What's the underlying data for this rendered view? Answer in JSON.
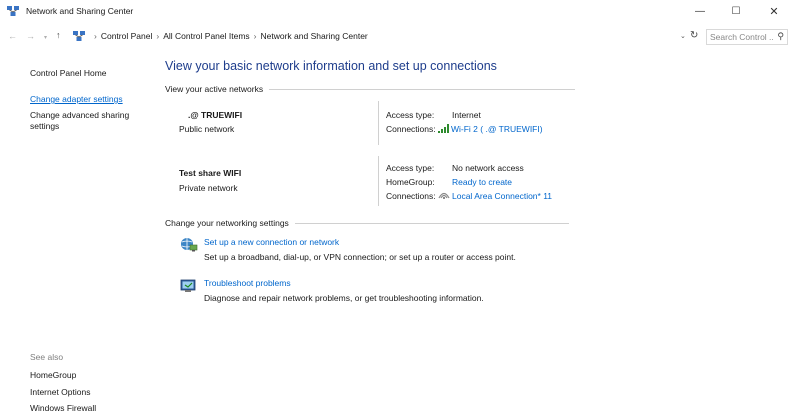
{
  "window": {
    "title": "Network and Sharing Center",
    "minimize_glyph": "—",
    "maximize_glyph": "☐",
    "close_glyph": "✕"
  },
  "address": {
    "back_glyph": "←",
    "forward_glyph": "→",
    "recent_glyph": "▾",
    "up_glyph": "↑",
    "breadcrumbs": [
      "Control Panel",
      "All Control Panel Items",
      "Network and Sharing Center"
    ],
    "breadcrumb_sep": "›",
    "dropdown_glyph": "⌄",
    "refresh_glyph": "↻",
    "search_placeholder": "Search Control ...",
    "search_glyph": "⚲"
  },
  "sidebar": {
    "home": "Control Panel Home",
    "adapter": "Change adapter settings",
    "advanced": "Change advanced sharing settings",
    "see_also": "See also",
    "links": [
      "HomeGroup",
      "Internet Options",
      "Windows Firewall"
    ]
  },
  "main": {
    "title": "View your basic network information and set up connections",
    "active_header": "View your active networks",
    "networks": [
      {
        "name": ".@  TRUEWIFI",
        "type": "Public network",
        "access_label": "Access type:",
        "access_value": "Internet",
        "connections_label": "Connections:",
        "connection_value": "Wi-Fi 2 (   .@  TRUEWIFI)",
        "connection_icon": "wifi-signal-icon"
      },
      {
        "name": "Test share WIFI",
        "type": "Private network",
        "access_label": "Access type:",
        "access_value": "No network access",
        "homegroup_label": "HomeGroup:",
        "homegroup_value": "Ready to create",
        "connections_label": "Connections:",
        "connection_value": "Local Area Connection* 11",
        "connection_icon": "ethernet-connection-icon"
      }
    ],
    "change_header": "Change your networking settings",
    "tasks": [
      {
        "link": "Set up a new connection or network",
        "desc": "Set up a broadband, dial-up, or VPN connection; or set up a router or access point.",
        "icon": "network-setup-icon"
      },
      {
        "link": "Troubleshoot problems",
        "desc": "Diagnose and repair network problems, or get troubleshooting information.",
        "icon": "troubleshoot-icon"
      }
    ]
  },
  "colors": {
    "link": "#0066cc",
    "title": "#1e3d8c",
    "wifi_signal": "#2e8b2e"
  }
}
